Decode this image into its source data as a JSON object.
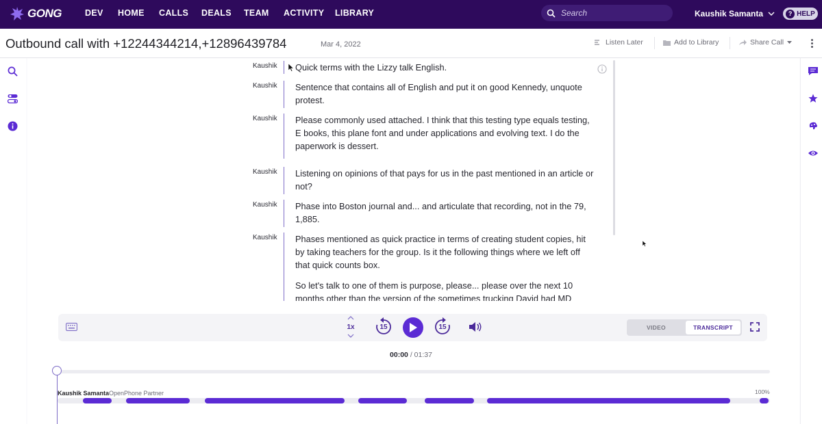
{
  "nav": {
    "logo": "GONG",
    "items": [
      "DEV",
      "HOME",
      "CALLS",
      "DEALS",
      "TEAM",
      "ACTIVITY",
      "LIBRARY"
    ],
    "search_placeholder": "Search",
    "user_name": "Kaushik Samanta",
    "help_label": "HELP"
  },
  "call": {
    "title": "Outbound call with +12244344214,+12896439784",
    "date": "Mar 4, 2022",
    "actions": {
      "listen_later": "Listen Later",
      "add_to_library": "Add to Library",
      "share_call": "Share Call"
    }
  },
  "transcript": [
    {
      "speaker": "Kaushik",
      "text": "Quick terms with the Lizzy talk English."
    },
    {
      "speaker": "Kaushik",
      "text": "Sentence that contains all of English and put it on good Kennedy, unquote protest."
    },
    {
      "speaker": "Kaushik",
      "text": "Please commonly used attached. I think that this testing type equals testing, E books, this plane font and under applications and evolving text. I do the paperwork is dessert."
    },
    {
      "speaker": "Kaushik",
      "text": "Listening on opinions of that pays for us in the past mentioned in an article or not?"
    },
    {
      "speaker": "Kaushik",
      "text": "Phase into Boston journal and... and articulate that recording, not in the 79, 1,885."
    },
    {
      "speaker": "Kaushik",
      "text": "Phases mentioned as quick practice in terms of creating student copies, hit by taking teachers for the group. Is it the following things where we left off that quick counts box."
    },
    {
      "speaker": "",
      "text": "So let's talk to one of them is purpose, please... please over the next 10 months other than the version of the sometimes trucking David had MD"
    }
  ],
  "player": {
    "speed": "1x",
    "rewind_seconds": "15",
    "forward_seconds": "15",
    "view_video": "VIDEO",
    "view_transcript": "TRANSCRIPT",
    "active_view": "TRANSCRIPT",
    "current_time": "00:00",
    "separator": " / ",
    "duration": "01:37",
    "progress": 0
  },
  "timeline": {
    "speaker_name": "Kaushik Samanta",
    "speaker_role": "OpenPhone Partner",
    "talk_percent": "100%"
  },
  "colors": {
    "nav_bg": "#2e0a5c",
    "accent": "#5b2bd4",
    "speaker_bar": "#7c6bc6"
  },
  "icons": {
    "left_rail": [
      "search-icon",
      "toggles-icon",
      "info-icon"
    ],
    "right_rail": [
      "comment-icon",
      "star-icon",
      "brain-icon",
      "eye-icon"
    ]
  }
}
